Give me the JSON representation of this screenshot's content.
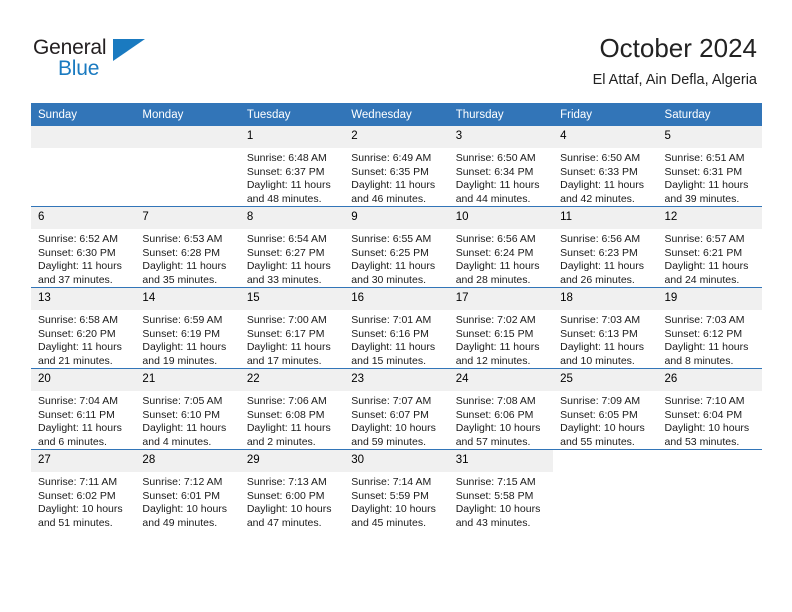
{
  "brand": {
    "name_top": "General",
    "name_bottom": "Blue",
    "triangle_icon": "triangle-icon",
    "accent_color": "#1a7ac0"
  },
  "header": {
    "title": "October 2024",
    "subtitle": "El Attaf, Ain Defla, Algeria",
    "header_color": "#3275b8"
  },
  "weekdays": [
    "Sunday",
    "Monday",
    "Tuesday",
    "Wednesday",
    "Thursday",
    "Friday",
    "Saturday"
  ],
  "labels": {
    "sunrise": "Sunrise:",
    "sunset": "Sunset:",
    "daylight": "Daylight:"
  },
  "weeks": [
    [
      {
        "day": "",
        "blank": true,
        "empty_strip": true
      },
      {
        "day": "",
        "blank": true,
        "empty_strip": true
      },
      {
        "day": "1",
        "sunrise": "Sunrise: 6:48 AM",
        "sunset": "Sunset: 6:37 PM",
        "daylight": "Daylight: 11 hours and 48 minutes."
      },
      {
        "day": "2",
        "sunrise": "Sunrise: 6:49 AM",
        "sunset": "Sunset: 6:35 PM",
        "daylight": "Daylight: 11 hours and 46 minutes."
      },
      {
        "day": "3",
        "sunrise": "Sunrise: 6:50 AM",
        "sunset": "Sunset: 6:34 PM",
        "daylight": "Daylight: 11 hours and 44 minutes."
      },
      {
        "day": "4",
        "sunrise": "Sunrise: 6:50 AM",
        "sunset": "Sunset: 6:33 PM",
        "daylight": "Daylight: 11 hours and 42 minutes."
      },
      {
        "day": "5",
        "sunrise": "Sunrise: 6:51 AM",
        "sunset": "Sunset: 6:31 PM",
        "daylight": "Daylight: 11 hours and 39 minutes."
      }
    ],
    [
      {
        "day": "6",
        "sunrise": "Sunrise: 6:52 AM",
        "sunset": "Sunset: 6:30 PM",
        "daylight": "Daylight: 11 hours and 37 minutes."
      },
      {
        "day": "7",
        "sunrise": "Sunrise: 6:53 AM",
        "sunset": "Sunset: 6:28 PM",
        "daylight": "Daylight: 11 hours and 35 minutes."
      },
      {
        "day": "8",
        "sunrise": "Sunrise: 6:54 AM",
        "sunset": "Sunset: 6:27 PM",
        "daylight": "Daylight: 11 hours and 33 minutes."
      },
      {
        "day": "9",
        "sunrise": "Sunrise: 6:55 AM",
        "sunset": "Sunset: 6:25 PM",
        "daylight": "Daylight: 11 hours and 30 minutes."
      },
      {
        "day": "10",
        "sunrise": "Sunrise: 6:56 AM",
        "sunset": "Sunset: 6:24 PM",
        "daylight": "Daylight: 11 hours and 28 minutes."
      },
      {
        "day": "11",
        "sunrise": "Sunrise: 6:56 AM",
        "sunset": "Sunset: 6:23 PM",
        "daylight": "Daylight: 11 hours and 26 minutes."
      },
      {
        "day": "12",
        "sunrise": "Sunrise: 6:57 AM",
        "sunset": "Sunset: 6:21 PM",
        "daylight": "Daylight: 11 hours and 24 minutes."
      }
    ],
    [
      {
        "day": "13",
        "sunrise": "Sunrise: 6:58 AM",
        "sunset": "Sunset: 6:20 PM",
        "daylight": "Daylight: 11 hours and 21 minutes."
      },
      {
        "day": "14",
        "sunrise": "Sunrise: 6:59 AM",
        "sunset": "Sunset: 6:19 PM",
        "daylight": "Daylight: 11 hours and 19 minutes."
      },
      {
        "day": "15",
        "sunrise": "Sunrise: 7:00 AM",
        "sunset": "Sunset: 6:17 PM",
        "daylight": "Daylight: 11 hours and 17 minutes."
      },
      {
        "day": "16",
        "sunrise": "Sunrise: 7:01 AM",
        "sunset": "Sunset: 6:16 PM",
        "daylight": "Daylight: 11 hours and 15 minutes."
      },
      {
        "day": "17",
        "sunrise": "Sunrise: 7:02 AM",
        "sunset": "Sunset: 6:15 PM",
        "daylight": "Daylight: 11 hours and 12 minutes."
      },
      {
        "day": "18",
        "sunrise": "Sunrise: 7:03 AM",
        "sunset": "Sunset: 6:13 PM",
        "daylight": "Daylight: 11 hours and 10 minutes."
      },
      {
        "day": "19",
        "sunrise": "Sunrise: 7:03 AM",
        "sunset": "Sunset: 6:12 PM",
        "daylight": "Daylight: 11 hours and 8 minutes."
      }
    ],
    [
      {
        "day": "20",
        "sunrise": "Sunrise: 7:04 AM",
        "sunset": "Sunset: 6:11 PM",
        "daylight": "Daylight: 11 hours and 6 minutes."
      },
      {
        "day": "21",
        "sunrise": "Sunrise: 7:05 AM",
        "sunset": "Sunset: 6:10 PM",
        "daylight": "Daylight: 11 hours and 4 minutes."
      },
      {
        "day": "22",
        "sunrise": "Sunrise: 7:06 AM",
        "sunset": "Sunset: 6:08 PM",
        "daylight": "Daylight: 11 hours and 2 minutes."
      },
      {
        "day": "23",
        "sunrise": "Sunrise: 7:07 AM",
        "sunset": "Sunset: 6:07 PM",
        "daylight": "Daylight: 10 hours and 59 minutes."
      },
      {
        "day": "24",
        "sunrise": "Sunrise: 7:08 AM",
        "sunset": "Sunset: 6:06 PM",
        "daylight": "Daylight: 10 hours and 57 minutes."
      },
      {
        "day": "25",
        "sunrise": "Sunrise: 7:09 AM",
        "sunset": "Sunset: 6:05 PM",
        "daylight": "Daylight: 10 hours and 55 minutes."
      },
      {
        "day": "26",
        "sunrise": "Sunrise: 7:10 AM",
        "sunset": "Sunset: 6:04 PM",
        "daylight": "Daylight: 10 hours and 53 minutes."
      }
    ],
    [
      {
        "day": "27",
        "sunrise": "Sunrise: 7:11 AM",
        "sunset": "Sunset: 6:02 PM",
        "daylight": "Daylight: 10 hours and 51 minutes."
      },
      {
        "day": "28",
        "sunrise": "Sunrise: 7:12 AM",
        "sunset": "Sunset: 6:01 PM",
        "daylight": "Daylight: 10 hours and 49 minutes."
      },
      {
        "day": "29",
        "sunrise": "Sunrise: 7:13 AM",
        "sunset": "Sunset: 6:00 PM",
        "daylight": "Daylight: 10 hours and 47 minutes."
      },
      {
        "day": "30",
        "sunrise": "Sunrise: 7:14 AM",
        "sunset": "Sunset: 5:59 PM",
        "daylight": "Daylight: 10 hours and 45 minutes."
      },
      {
        "day": "31",
        "sunrise": "Sunrise: 7:15 AM",
        "sunset": "Sunset: 5:58 PM",
        "daylight": "Daylight: 10 hours and 43 minutes."
      },
      {
        "day": "",
        "blank": true
      },
      {
        "day": "",
        "blank": true
      }
    ]
  ]
}
